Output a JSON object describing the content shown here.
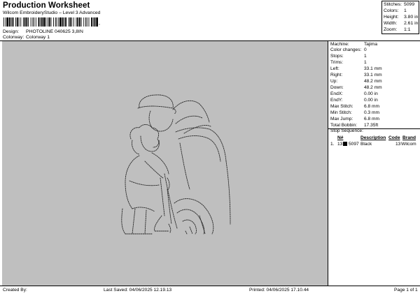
{
  "header": {
    "title": "Production Worksheet",
    "subtitle": "Wilcom EmbroideryStudio – Level 3 Advanced",
    "barcode_mark": ",",
    "design_label": "Design:",
    "design_value": "PHOTOLINE 040625 3,8IN",
    "colorway_label": "Colorway:",
    "colorway_value": "Colorway 1"
  },
  "stats": [
    {
      "label": "Stitches:",
      "value": "5099"
    },
    {
      "label": "Colors:",
      "value": "1"
    },
    {
      "label": "Height:",
      "value": "3.80 in"
    },
    {
      "label": "Width:",
      "value": "2.61 in"
    },
    {
      "label": "Zoom:",
      "value": "1:1"
    }
  ],
  "machine_info": [
    {
      "label": "Machine:",
      "value": "Tajima"
    },
    {
      "label": "Color changes:",
      "value": "0"
    },
    {
      "label": "Stops:",
      "value": "1"
    },
    {
      "label": "Trims:",
      "value": "1"
    },
    {
      "label": "Left:",
      "value": "33.1 mm"
    },
    {
      "label": "Right:",
      "value": "33.1 mm"
    },
    {
      "label": "Up:",
      "value": "48.2 mm"
    },
    {
      "label": "Down:",
      "value": "48.2 mm"
    },
    {
      "label": "EndX:",
      "value": "0.00 in"
    },
    {
      "label": "EndY:",
      "value": "0.00 in"
    },
    {
      "label": "Max Stitch:",
      "value": "6.8 mm"
    },
    {
      "label": "Min Stitch:",
      "value": "0.3 mm"
    },
    {
      "label": "Max Jump:",
      "value": "6.8 mm"
    },
    {
      "label": "Total Bobbin:",
      "value": "17.35ft"
    }
  ],
  "stop_sequence": {
    "heading": "Stop Sequence:",
    "columns": {
      "n": "N#",
      "description": "Description",
      "code": "Code",
      "brand": "Brand"
    },
    "row": {
      "index": "1.",
      "n": "13",
      "swatch_color": "#000000",
      "stitches": "5097",
      "description": "Black",
      "code": "13",
      "brand": "Wilcom"
    }
  },
  "footer": {
    "created_by": "Created By:",
    "last_saved": "Last Saved: 04/06/2025 12.19.13",
    "printed": "Printed: 04/06/2025 17.10.44",
    "page": "Page 1 of 1"
  },
  "colors": {
    "canvas_bg": "#bfbfbf",
    "stitch": "#2a2a2a"
  }
}
